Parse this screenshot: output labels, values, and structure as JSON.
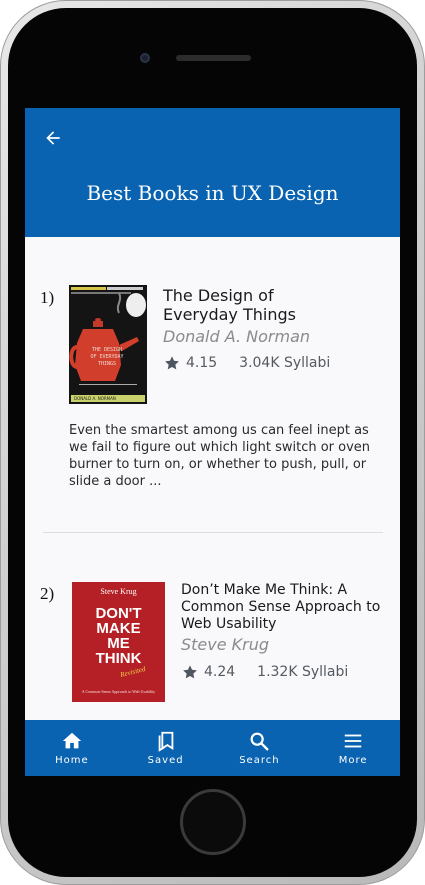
{
  "header": {
    "title": "Best Books in UX Design",
    "back_icon": "arrow-left-icon"
  },
  "books": [
    {
      "rank": "1)",
      "title_line1": "The Design of",
      "title_line2": "Everyday Things",
      "author": "Donald A. Norman",
      "rating": "4.15",
      "syllabi": "3.04K Syllabi",
      "description_lines": [
        "Even the smartest among us can feel inept as",
        "we fail to figure out which light switch or oven",
        "burner to turn on, or whether to push, pull, or",
        "slide a door ..."
      ],
      "cover": {
        "author_small": "DONALD A. NORMAN",
        "title_vertical": "THE DESIGN OF EVERYDAY THINGS"
      }
    },
    {
      "rank": "2)",
      "title_line1": "Don’t Make Me Think: A",
      "title_line2": "Common Sense Approach to",
      "title_line3": "Web Usability",
      "author": "Steve Krug",
      "rating": "4.24",
      "syllabi": "1.32K Syllabi",
      "cover": {
        "author": "Steve Krug",
        "line1": "DON'T",
        "line2": "MAKE",
        "line3": "ME",
        "line4": "THINK",
        "revisited": "Revisited",
        "subtitle": "A Common Sense Approach to Web Usability"
      }
    }
  ],
  "nav": [
    {
      "label": "Home",
      "icon": "home-icon"
    },
    {
      "label": "Saved",
      "icon": "bookmark-icon"
    },
    {
      "label": "Search",
      "icon": "search-icon"
    },
    {
      "label": "More",
      "icon": "menu-icon"
    }
  ],
  "colors": {
    "brand": "#0a63b0",
    "background": "#f9f9fc"
  }
}
